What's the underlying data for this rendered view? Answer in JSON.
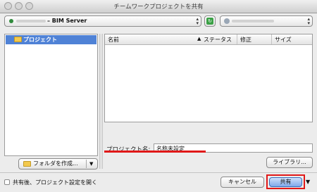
{
  "window": {
    "title": "チームワークプロジェクトを共有"
  },
  "server_select": {
    "value": "– BIM Server"
  },
  "left_panel": {
    "selected_item": "プロジェクト"
  },
  "columns": {
    "name": "名前",
    "status": "ステータス",
    "modified": "修正",
    "size": "サイズ"
  },
  "project_name": {
    "label": "プロジェクト名:",
    "value": "名称未設定"
  },
  "buttons": {
    "create_folder": "フォルダを作成...",
    "libraries": "ライブラリ...",
    "cancel": "キャンセル",
    "share": "共有"
  },
  "checkbox": {
    "label": "共有後、プロジェクト設定を開く"
  },
  "colors": {
    "selection": "#4f82d6",
    "annotation_red": "#e01818"
  }
}
